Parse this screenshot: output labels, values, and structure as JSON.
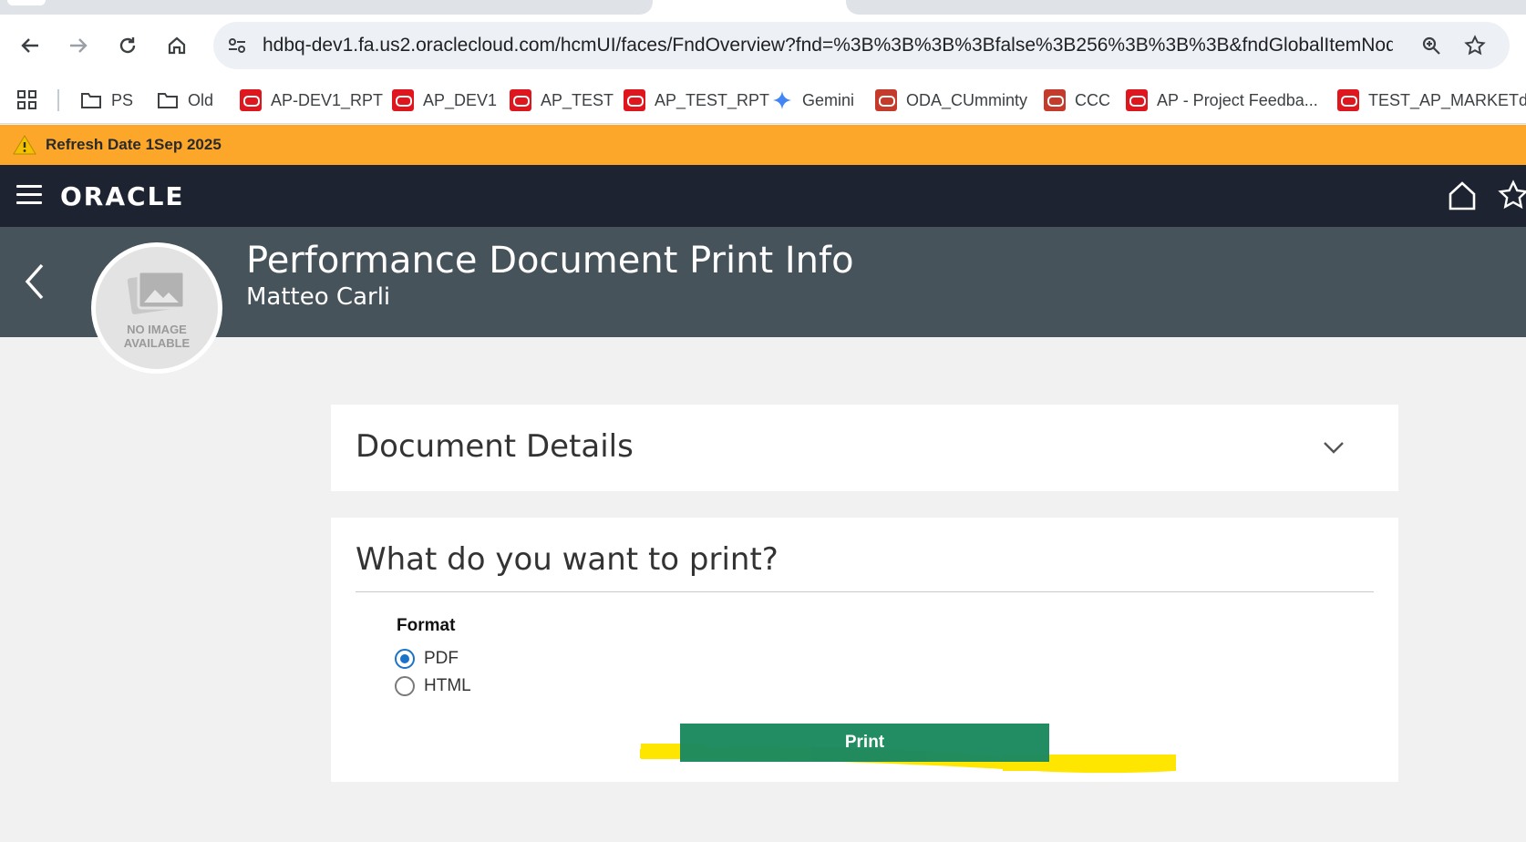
{
  "browser": {
    "url": "hdbq-dev1.fa.us2.oraclecloud.com/hcmUI/faces/FndOverview?fnd=%3B%3B%3B%3Bfalse%3B256%3B%3B%3B&fndGlobalItemNodeI...",
    "bookmarks": [
      {
        "label": "PS",
        "icon": "folder-icon"
      },
      {
        "label": "Old",
        "icon": "folder-icon"
      },
      {
        "label": "AP-DEV1_RPT",
        "icon": "oracle-icon"
      },
      {
        "label": "AP_DEV1",
        "icon": "oracle-icon"
      },
      {
        "label": "AP_TEST",
        "icon": "oracle-icon"
      },
      {
        "label": "AP_TEST_RPT",
        "icon": "oracle-icon"
      },
      {
        "label": "Gemini",
        "icon": "gemini-icon"
      },
      {
        "label": "ODA_CUmminty",
        "icon": "oracle-icon"
      },
      {
        "label": "CCC",
        "icon": "oracle-icon"
      },
      {
        "label": "AP - Project Feedba...",
        "icon": "oracle-icon"
      },
      {
        "label": "TEST_AP_MARKETda...",
        "icon": "oracle-icon"
      }
    ]
  },
  "banner": {
    "text": "Refresh Date 1Sep 2025",
    "color": "#fca72a"
  },
  "appbar": {
    "logo": "ORACLE",
    "color": "#1d2330"
  },
  "page": {
    "title": "Performance Document Print Info",
    "person": "Matteo Carli",
    "avatar_text": "NO IMAGE AVAILABLE"
  },
  "details_section": {
    "title": "Document Details"
  },
  "print_section": {
    "title": "What do you want to print?",
    "format_label": "Format",
    "options": [
      {
        "label": "PDF",
        "selected": true
      },
      {
        "label": "HTML",
        "selected": false
      }
    ],
    "print_button": "Print",
    "accent": "#1e8a5f"
  }
}
